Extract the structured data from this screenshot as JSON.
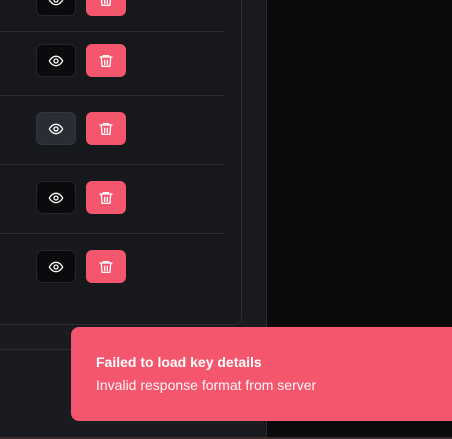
{
  "key_list": {
    "rows": [
      {
        "view_icon": "eye-icon",
        "delete_icon": "trash-icon",
        "view_state": "default"
      },
      {
        "view_icon": "eye-icon",
        "delete_icon": "trash-icon",
        "view_state": "default"
      },
      {
        "view_icon": "eye-icon",
        "delete_icon": "trash-icon",
        "view_state": "hover"
      },
      {
        "view_icon": "eye-icon",
        "delete_icon": "trash-icon",
        "view_state": "default"
      },
      {
        "view_icon": "eye-icon",
        "delete_icon": "trash-icon",
        "view_state": "default"
      }
    ]
  },
  "toast": {
    "title": "Failed to load key details",
    "description": "Invalid response format from server",
    "color": "#f4566d"
  },
  "colors": {
    "danger": "#f4566d",
    "surface": "#17181c",
    "background": "#1a1b20",
    "panel_dark": "#0a0a0b"
  }
}
